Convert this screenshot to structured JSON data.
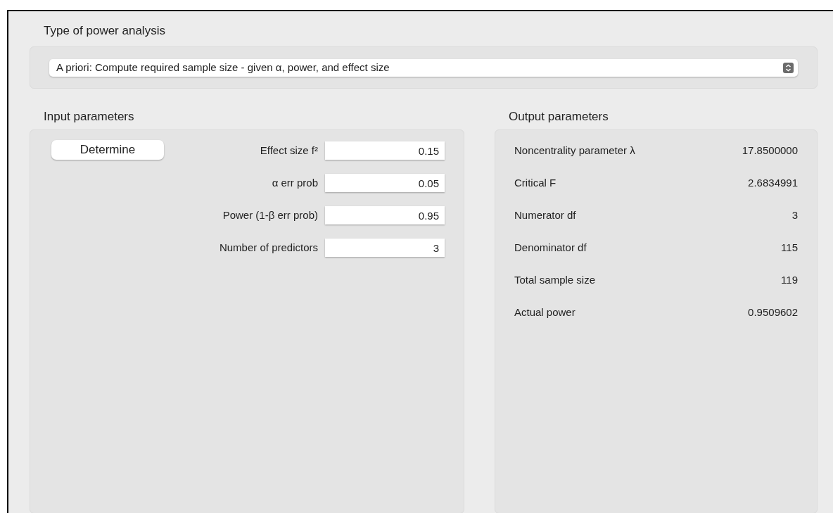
{
  "analysis_type": {
    "label": "Type of power analysis",
    "value": "A priori: Compute required sample size - given α, power, and effect size"
  },
  "input": {
    "title": "Input parameters",
    "button": "Determine",
    "params": [
      {
        "label": "Effect size f²",
        "value": "0.15"
      },
      {
        "label": "α err prob",
        "value": "0.05"
      },
      {
        "label": "Power (1-β err prob)",
        "value": "0.95"
      },
      {
        "label": "Number of predictors",
        "value": "3"
      }
    ]
  },
  "output": {
    "title": "Output parameters",
    "params": [
      {
        "label": "Noncentrality parameter λ",
        "value": "17.8500000"
      },
      {
        "label": "Critical F",
        "value": "2.6834991"
      },
      {
        "label": "Numerator df",
        "value": "3"
      },
      {
        "label": "Denominator df",
        "value": "115"
      },
      {
        "label": "Total sample size",
        "value": "119"
      },
      {
        "label": "Actual power",
        "value": "0.9509602"
      }
    ]
  }
}
